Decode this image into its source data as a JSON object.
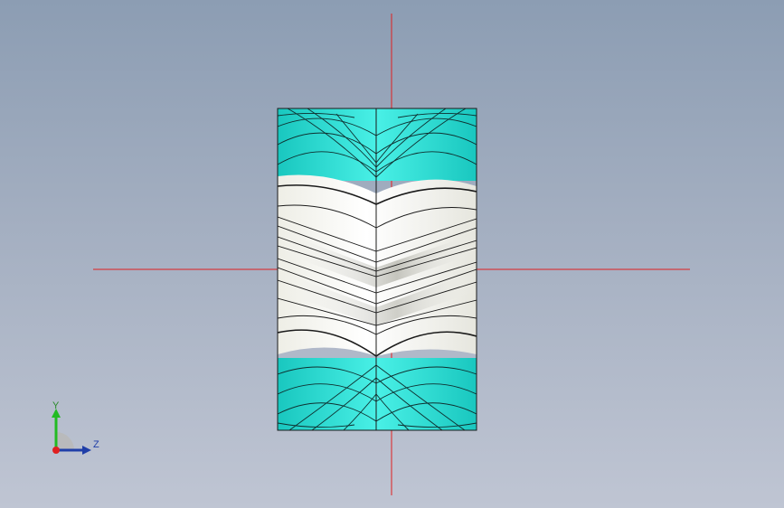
{
  "viewport": {
    "background_top": "#8c9db3",
    "background_bottom": "#bfc5d3",
    "crosshair_color": "#e02020"
  },
  "model": {
    "type": "herringbone-gear-side-view",
    "teeth_color": "#2ee6d6",
    "teeth_light": "#7ff5ee",
    "body_color": "#f4f4ef",
    "edge_color": "#1a1a1a"
  },
  "triad": {
    "y_label": "Y",
    "z_label": "Z",
    "y_color": "#22bb22",
    "z_color": "#1f3ea8",
    "x_color": "#e02020"
  }
}
